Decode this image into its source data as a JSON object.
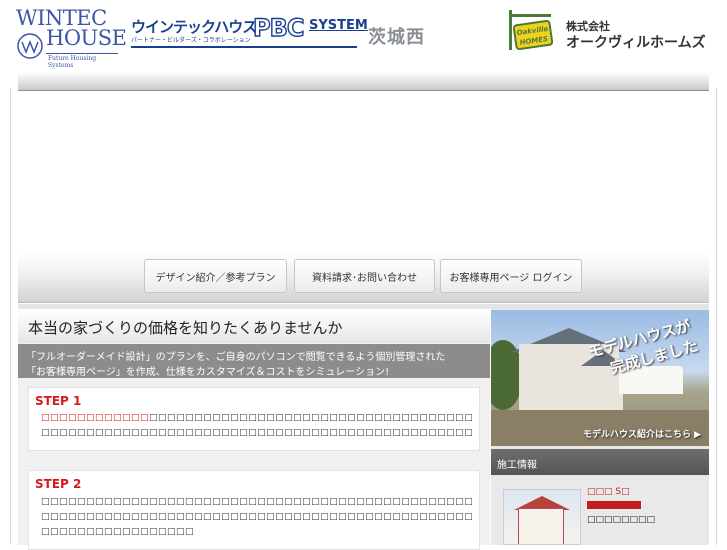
{
  "header": {
    "wintec_line1": "WINTEC",
    "wintec_line2": "HOUSE",
    "wintec_sub": "Future Housing Systems",
    "pbc_main": "ウインテックハウス",
    "pbc_sub": "パートナー・ビルダーズ・コラボレーション",
    "pbc_big": "PBC",
    "pbc_system": "SYSTEM",
    "region": "茨城西",
    "oak_sign": "Oakville HOMES",
    "company_small": "株式会社",
    "company_big": "オークヴィルホームズ"
  },
  "nav": {
    "design": "デザイン紹介／参考プラン",
    "request": "資料請求･お問い合わせ",
    "login": "お客様専用ページ ログイン"
  },
  "main": {
    "title": "本当の家づくりの価格を知りたくありませんか",
    "intro_line1": "「フルオーダーメイド設計」のプランを、ご自身のパソコンで閲覧できるよう個別管理された",
    "intro_line2": "「お客様専用ページ」を作成、仕様をカスタマイズ＆コストをシミュレーション!",
    "step1_title": "STEP 1",
    "step1_red": "□□□□□□□□□□□□",
    "step1_line1": "□□□□□□□□□□□□□□□□□□□□□□□□□□□□□□□□□□□□□□□□□□□□□□□□□□□□□□□□□□□□□□□□",
    "step1_line2": "□□□□□□□□□□□□□□□□□□□□□□□□□□□□□□□□□□□□□□□□□□□□□□□□□□□□□□□□□□□□",
    "step2_title": "STEP 2",
    "step2_line1": "□□□□□□□□□□□□□□□□□□□□□□□□□□□□□□□□□□□□□□□□□□□□□□□□",
    "step2_line2": "□□□□□□□□□□□□□□□□□□□□□□□□□□□□□□□□□□□□□□□□□□□□□□□□□□□□□□□□□□□□□□□□□□□□□□□□□□□",
    "step2_line3": "□□□□□□□□□□□□□□□□□"
  },
  "side": {
    "banner_catch1": "モデルハウスが",
    "banner_catch2": "完成しました",
    "banner_link": "モデルハウス紹介はこちら ▶",
    "construction_label": "施工情報",
    "work_name": "□□□ S□",
    "work_desc": "□□□□□□□□"
  }
}
